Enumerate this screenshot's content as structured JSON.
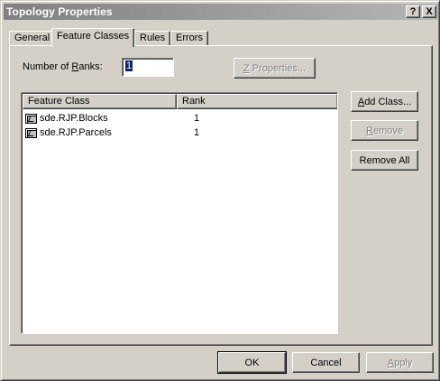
{
  "window": {
    "title": "Topology Properties",
    "help_glyph": "?",
    "close_glyph": "X"
  },
  "tabs": [
    {
      "label": "General",
      "active": false
    },
    {
      "label": "Feature Classes",
      "active": true
    },
    {
      "label": "Rules",
      "active": false
    },
    {
      "label": "Errors",
      "active": false
    }
  ],
  "ranks": {
    "label_pre": "Number of ",
    "label_u": "R",
    "label_post": "anks:",
    "value": "1"
  },
  "z_properties": {
    "u": "Z",
    "rest": " Properties...",
    "enabled": false
  },
  "list": {
    "columns": [
      "Feature Class",
      "Rank"
    ],
    "rows": [
      {
        "icon": "feature-class-icon",
        "name": "sde.RJP.Blocks",
        "rank": "1"
      },
      {
        "icon": "feature-class-icon",
        "name": "sde.RJP.Parcels",
        "rank": "1"
      }
    ]
  },
  "side_buttons": {
    "add": {
      "u": "A",
      "rest": "dd Class...",
      "enabled": true
    },
    "remove": {
      "u": "R",
      "rest": "emove",
      "enabled": false
    },
    "remove_all": {
      "label": "Remove All",
      "enabled": true
    }
  },
  "footer": {
    "ok": "OK",
    "cancel": "Cancel",
    "apply_u": "A",
    "apply_rest": "pply"
  },
  "colors": {
    "face": "#d4d0c8",
    "titlebar_start": "#808080",
    "titlebar_end": "#b5b5b5",
    "selection": "#0a246a",
    "disabled_text": "#808080"
  }
}
